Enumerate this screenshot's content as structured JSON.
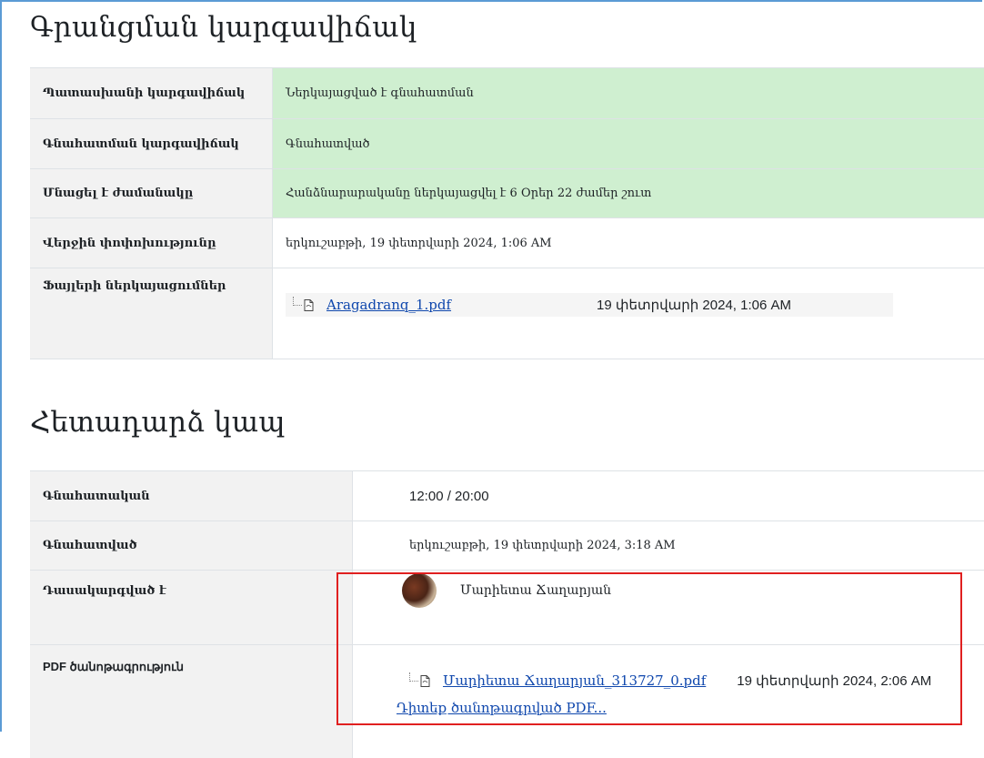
{
  "submission": {
    "heading": "Գրանցման կարգավիճակ",
    "rows": [
      {
        "label": "Պատասխանի կարգավիճակ",
        "value": "Ներկայացված է գնահատման"
      },
      {
        "label": "Գնահատման կարգավիճակ",
        "value": "Գնահատված"
      },
      {
        "label": "Մնացել է ժամանակը",
        "value": "Հանձնարարականը ներկայացվել է 6 Օրեր 22 ժամեր շուտ"
      },
      {
        "label": "Վերջին փոփոխությունը",
        "value": "երկուշաբթի, 19 փետրվարի 2024, 1:06 AM"
      },
      {
        "label": "Ֆայլերի ներկայացումներ"
      }
    ],
    "file": {
      "name": "Aragadranq_1.pdf",
      "date": "19 փետրվարի 2024, 1:06 AM",
      "icon": "file-pdf-icon"
    },
    "highlight_color": "#cfefd0"
  },
  "feedback": {
    "heading": "Հետադարձ կապ",
    "grade_label": "Գնահատական",
    "grade_value": "12:00 / 20:00",
    "graded_on_label": "Գնահատված",
    "graded_on_value": "երկուշաբթի, 19 փետրվարի 2024, 3:18 AM",
    "graded_by_label": "Դասակարգված է",
    "grader_name": "Մարիետա Ճաղարյան",
    "annotation_label": "PDF ծանոթագրություն",
    "annotated_file": {
      "name": "Մարիետա Ճաղարյան_313727_0.pdf",
      "date": "19 փետրվարի 2024, 2:06 AM",
      "icon": "file-pdf-icon"
    },
    "view_link": "Դիտեք ծանոթագրված PDF..."
  },
  "colors": {
    "link": "#0f47ad",
    "frame": "#5b9bd5",
    "callout": "#e02020"
  }
}
